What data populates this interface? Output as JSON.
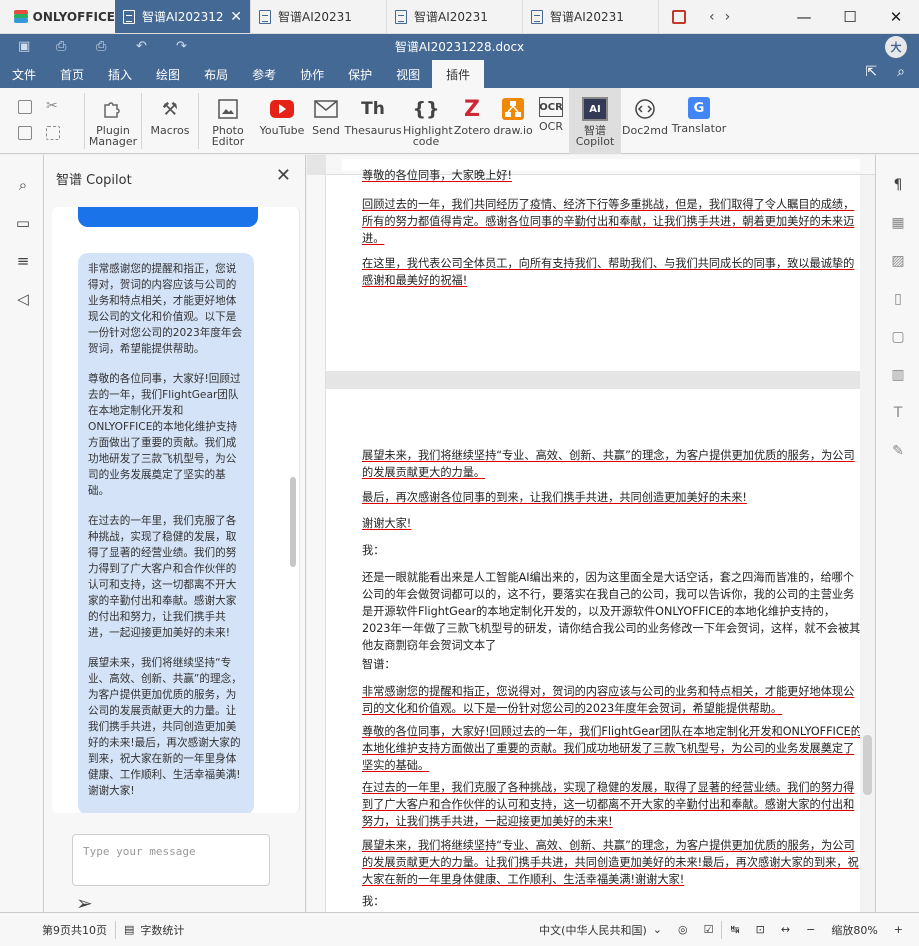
{
  "app": {
    "name": "ONLYOFFICE"
  },
  "tabs": [
    {
      "label": "智谱AI20231228.d",
      "active": true
    },
    {
      "label": "智谱AI20231"
    },
    {
      "label": "智谱AI20231"
    },
    {
      "label": "智谱AI20231"
    }
  ],
  "header": {
    "doc_title": "智谱AI20231228.docx",
    "avatar": "大"
  },
  "menu": [
    "文件",
    "首页",
    "插入",
    "绘图",
    "布局",
    "参考",
    "协作",
    "保护",
    "视图",
    "插件"
  ],
  "toolbar": {
    "plugin_manager": "Plugin Manager",
    "macros": "Macros",
    "photo_editor": "Photo Editor",
    "youtube": "YouTube",
    "send": "Send",
    "thesaurus": "Thesaurus",
    "highlight_code": "Highlight code",
    "zotero": "Zotero",
    "drawio": "draw.io",
    "ocr": "OCR",
    "zhipu_copilot": "智谱 Copilot",
    "doc2md": "Doc2md",
    "translator": "Translator",
    "th_glyph": "Th",
    "braces_glyph": "{}",
    "zotero_glyph": "Z",
    "ocr_glyph": "OCR",
    "ai_glyph": "AI",
    "g_glyph": "G"
  },
  "panel": {
    "title": "智谱 Copilot",
    "input_placeholder": "Type your message",
    "bot_paragraphs": [
      "非常感谢您的提醒和指正，您说得对，贺词的内容应该与公司的业务和特点相关，才能更好地体现公司的文化和价值观。以下是一份针对您公司的2023年度年会贺词，希望能提供帮助。",
      "尊敬的各位同事，大家好!回顾过去的一年，我们FlightGear团队在本地定制化开发和ONLYOFFICE的本地化维护支持方面做出了重要的贡献。我们成功地研发了三款飞机型号，为公司的业务发展奠定了坚实的基础。",
      "在过去的一年里，我们克服了各种挑战，实现了稳健的发展，取得了显著的经营业绩。我们的努力得到了广大客户和合作伙伴的认可和支持，这一切都离不开大家的辛勤付出和奉献。感谢大家的付出和努力，让我们携手共进，一起迎接更加美好的未来!",
      "展望未来，我们将继续坚持“专业、高效、创新、共赢”的理念，为客户提供更加优质的服务，为公司的发展贡献更大的力量。让我们携手共进，共同创造更加美好的未来!最后，再次感谢大家的到来，祝大家在新的一年里身体健康、工作顺利、生活幸福美满!谢谢大家!"
    ]
  },
  "document": {
    "page1": [
      "尊敬的各位同事，大家晚上好!",
      "回顾过去的一年，我们共同经历了疫情、经济下行等多重挑战，但是，我们取得了令人瞩目的成绩，所有的努力都值得肯定。感谢各位同事的辛勤付出和奉献，让我们携手共进，朝着更加美好的未来迈进。",
      "在这里，我代表公司全体员工，向所有支持我们、帮助我们、与我们共同成长的同事，致以最诚挚的感谢和最美好的祝福!"
    ],
    "page2": [
      "展望未来，我们将继续坚持“专业、高效、创新、共赢”的理念，为客户提供更加优质的服务，为公司的发展贡献更大的力量。",
      "最后，再次感谢各位同事的到来，让我们携手共进，共同创造更加美好的未来!",
      "谢谢大家!",
      "我：",
      "还是一眼就能看出来是人工智能AI编出来的，因为这里面全是大话空话，套之四海而皆准的，给哪个公司的年会做贺词都可以的，这不行，要落实在我自己的公司，我可以告诉你，我的公司的主营业务是开源软件FlightGear的本地定制化开发的，以及开源软件ONLYOFFICE的本地化维护支持的，2023年一年做了三款飞机型号的研发，请你结合我公司的业务修改一下年会贺词，这样，就不会被其他友商剽窃年会贺词文本了",
      "智谱：",
      "非常感谢您的提醒和指正，您说得对，贺词的内容应该与公司的业务和特点相关，才能更好地体现公司的文化和价值观。以下是一份针对您公司的2023年度年会贺词，希望能提供帮助。",
      "尊敬的各位同事，大家好!回顾过去的一年，我们FlightGear团队在本地定制化开发和ONLYOFFICE的本地化维护支持方面做出了重要的贡献。我们成功地研发了三款飞机型号，为公司的业务发展奠定了坚实的基础。",
      "在过去的一年里，我们克服了各种挑战，实现了稳健的发展，取得了显著的经营业绩。我们的努力得到了广大客户和合作伙伴的认可和支持，这一切都离不开大家的辛勤付出和奉献。感谢大家的付出和努力，让我们携手共进，一起迎接更加美好的未来!",
      "展望未来，我们将继续坚持“专业、高效、创新、共赢”的理念，为客户提供更加优质的服务，为公司的发展贡献更大的力量。让我们携手共进，共同创造更加美好的未来!最后，再次感谢大家的到来，祝大家在新的一年里身体健康、工作顺利、生活幸福美满!谢谢大家!",
      "我："
    ]
  },
  "status": {
    "page_count": "第9页共10页",
    "word_count": "字数统计",
    "language": "中文(中华人民共和国)",
    "zoom": "缩放80%"
  },
  "colors": {
    "accent": "#446995",
    "user_bubble": "#1a73e8",
    "bot_bubble": "#d4e3f7",
    "spell_underline": "#dd0000"
  }
}
